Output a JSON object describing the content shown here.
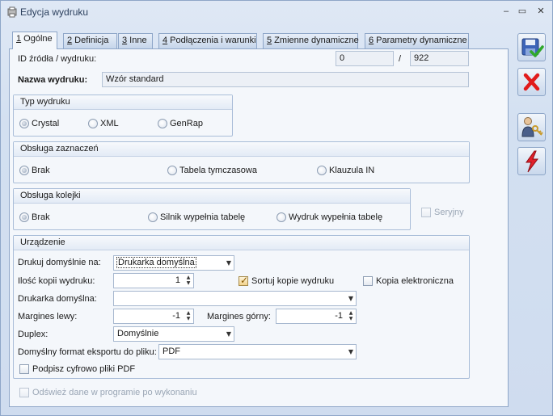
{
  "window": {
    "title": "Edycja wydruku",
    "controls": {
      "minimize": "‒",
      "maximize": "▭",
      "close": "✕"
    }
  },
  "tabs": [
    {
      "num": "1",
      "label": " Ogólne"
    },
    {
      "num": "2",
      "label": " Definicja"
    },
    {
      "num": "3",
      "label": " Inne"
    },
    {
      "num": "4",
      "label": " Podłączenia i warunki"
    },
    {
      "num": "5",
      "label": " Zmienne dynamiczne"
    },
    {
      "num": "6",
      "label": " Parametry dynamiczne"
    }
  ],
  "general": {
    "id_label": "ID źródła / wydruku:",
    "id_source": "0",
    "id_separator": "/",
    "id_print": "922",
    "name_label": "Nazwa wydruku:",
    "name_value": "Wzór standard"
  },
  "print_type": {
    "title": "Typ wydruku",
    "options": [
      "Crystal",
      "XML",
      "GenRap"
    ],
    "selected": "Crystal"
  },
  "selection_handling": {
    "title": "Obsługa zaznaczeń",
    "options": [
      "Brak",
      "Tabela tymczasowa",
      "Klauzula IN"
    ],
    "selected": "Brak"
  },
  "queue_handling": {
    "title": "Obsługa kolejki",
    "options": [
      "Brak",
      "Silnik wypełnia tabelę",
      "Wydruk wypełnia tabelę"
    ],
    "selected": "Brak",
    "serial_label": "Seryjny"
  },
  "device": {
    "title": "Urządzenie",
    "default_print_label": "Drukuj domyślnie na:",
    "default_print_value": "Drukarka domyślna",
    "copies_label": "Ilość kopii wydruku:",
    "copies_value": "1",
    "sort_copies_label": "Sortuj kopie wydruku",
    "e_copy_label": "Kopia elektroniczna",
    "default_printer_label": "Drukarka domyślna:",
    "default_printer_value": "",
    "margin_left_label": "Margines lewy:",
    "margin_left_value": "-1",
    "margin_top_label": "Margines górny:",
    "margin_top_value": "-1",
    "duplex_label": "Duplex:",
    "duplex_value": "Domyślnie",
    "export_format_label": "Domyślny format eksportu do pliku:",
    "export_format_value": "PDF",
    "sign_pdf_label": "Podpisz cyfrowo pliki PDF"
  },
  "refresh_label": "Odśwież dane w programie po wykonaniu",
  "icons": [
    "save-icon",
    "cancel-icon",
    "user-key-icon",
    "lightning-icon"
  ]
}
